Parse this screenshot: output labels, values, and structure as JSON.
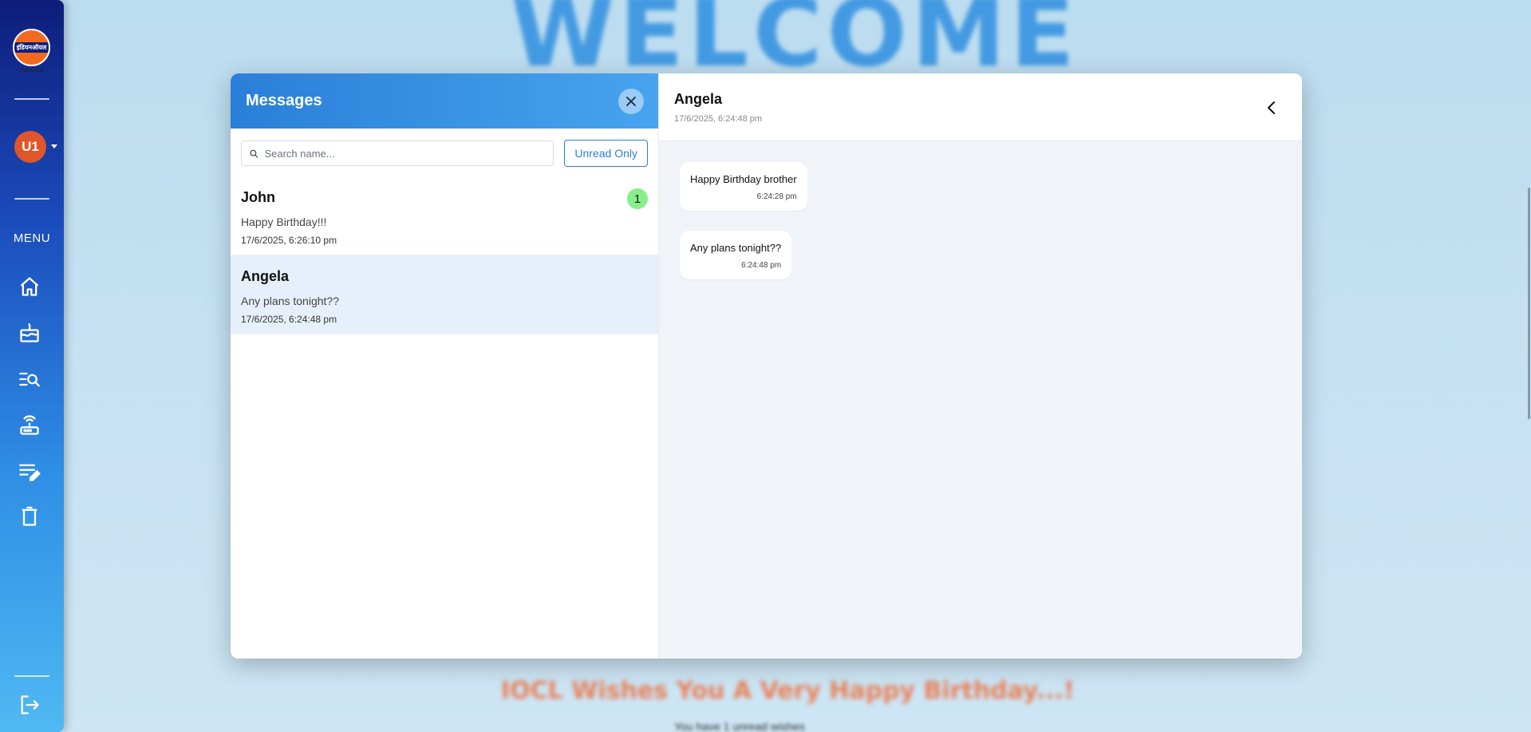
{
  "background": {
    "welcome": "WELCOME",
    "wishes": "IOCL Wishes You A Very Happy Birthday...!",
    "sub": "You have 1 unread wishes"
  },
  "sidebar": {
    "logo_text": "इंडियनऑयल",
    "logo_sub": "IndianOil",
    "avatar": "U1",
    "menu_label": "MENU",
    "nav": [
      {
        "name": "home",
        "icon": "home-icon"
      },
      {
        "name": "birthday",
        "icon": "cake-icon"
      },
      {
        "name": "search-list",
        "icon": "list-search-icon"
      },
      {
        "name": "router",
        "icon": "router-icon"
      },
      {
        "name": "edit-notes",
        "icon": "edit-notes-icon"
      },
      {
        "name": "delete",
        "icon": "trash-icon"
      }
    ],
    "logout_icon": "logout-icon"
  },
  "messages_panel": {
    "title": "Messages",
    "search_placeholder": "Search name...",
    "search_value": "",
    "unread_only_label": "Unread Only",
    "conversations": [
      {
        "name": "John",
        "preview": "Happy Birthday!!!",
        "time": "17/6/2025, 6:26:10 pm",
        "unread": "1"
      },
      {
        "name": "Angela",
        "preview": "Any plans tonight??",
        "time": "17/6/2025, 6:24:48 pm",
        "unread": ""
      }
    ]
  },
  "chat": {
    "name": "Angela",
    "time": "17/6/2025, 6:24:48 pm",
    "messages": [
      {
        "text": "Happy Birthday brother",
        "time": "6:24:28 pm"
      },
      {
        "text": "Any plans tonight??",
        "time": "6:24:48 pm"
      }
    ]
  },
  "colors": {
    "header_gradient_start": "#2a7fd8",
    "header_gradient_end": "#47a4ef",
    "unread_badge": "#86ef8a",
    "active_conversation": "#e7f0fa",
    "avatar": "#e0562a"
  }
}
